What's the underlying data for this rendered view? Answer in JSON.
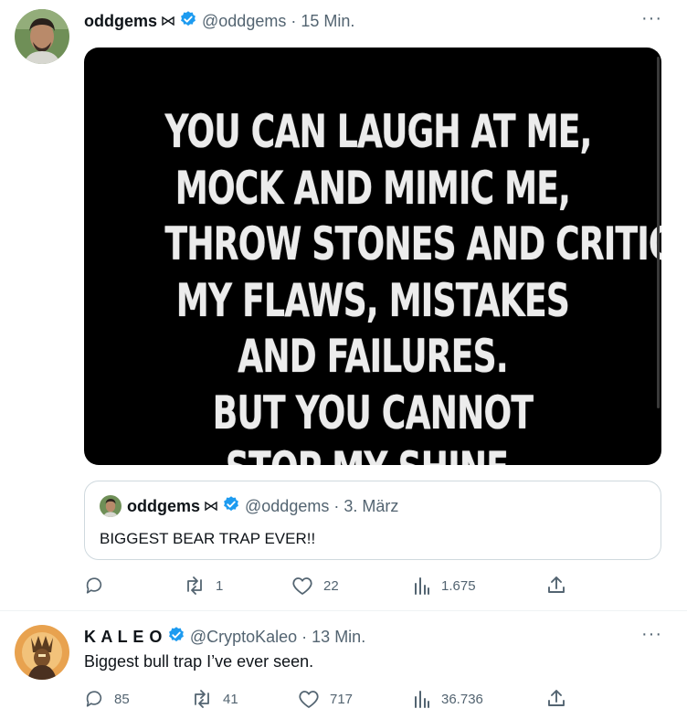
{
  "tweet1": {
    "display_name": "oddgems",
    "handle": "@oddgems",
    "time": "· 15 Min.",
    "more": "···",
    "poster_lines": [
      "YOU CAN LAUGH AT ME,",
      "MOCK AND MIMIC ME,",
      "THROW STONES AND CRITICIZE",
      "MY FLAWS, MISTAKES",
      "AND FAILURES.",
      "BUT YOU CANNOT",
      "STOP MY SHINE."
    ],
    "quoted": {
      "display_name": "oddgems",
      "handle": "@oddgems",
      "time": "· 3. März",
      "text": "BIGGEST BEAR TRAP EVER!!"
    },
    "actions": {
      "reply": "",
      "retweet": "1",
      "like": "22",
      "views": "1.675"
    }
  },
  "tweet2": {
    "display_name": "K A L E O",
    "handle": "@CryptoKaleo",
    "time": "· 13 Min.",
    "more": "···",
    "text": "Biggest bull trap I’ve ever seen.",
    "actions": {
      "reply": "85",
      "retweet": "41",
      "like": "717",
      "views": "36.736"
    }
  },
  "colors": {
    "verified": "#1d9bf0",
    "secondary_text": "#536471",
    "border": "#cfd9de"
  }
}
